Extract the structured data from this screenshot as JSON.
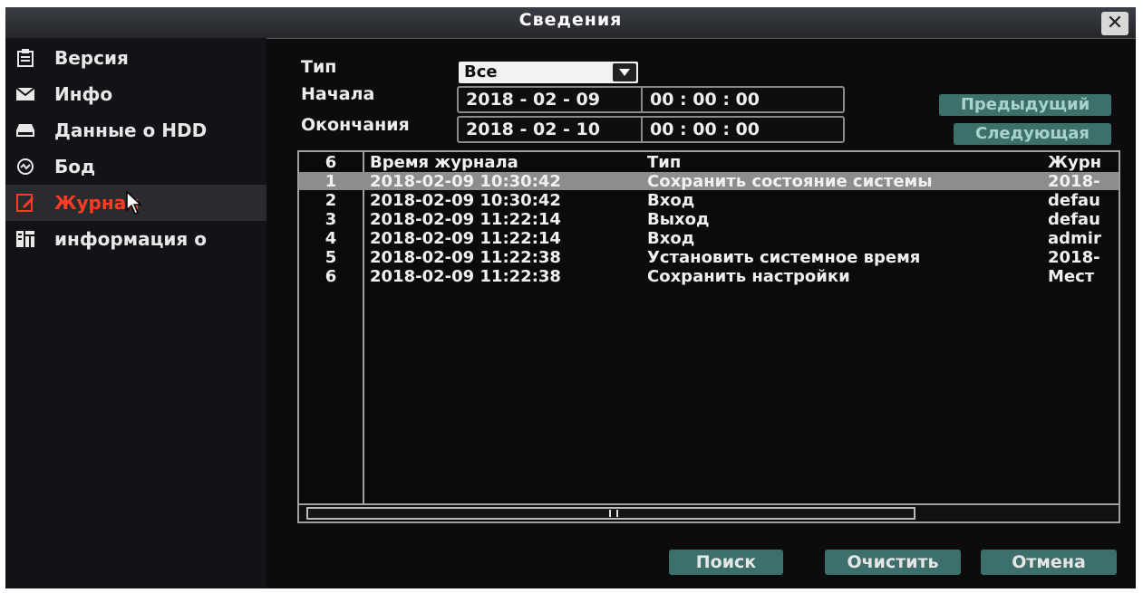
{
  "window": {
    "title": "Сведения"
  },
  "sidebar": {
    "items": [
      {
        "label": "Версия",
        "icon": "clipboard-icon"
      },
      {
        "label": "Инфо",
        "icon": "envelope-icon"
      },
      {
        "label": "Данные о HDD",
        "icon": "hdd-icon"
      },
      {
        "label": "Бод",
        "icon": "gauge-icon"
      },
      {
        "label": "Журнал",
        "icon": "log-icon",
        "active": true
      },
      {
        "label": "информация о",
        "icon": "info-grid-icon"
      }
    ]
  },
  "filter": {
    "type_label": "Тип",
    "type_value": "Все",
    "start_label": "Начала",
    "start_date": "2018 - 02 - 09",
    "start_time": "00 : 00 : 00",
    "end_label": "Окончания",
    "end_date": "2018 - 02 - 10",
    "end_time": "00 : 00 : 00",
    "prev_label": "Предыдущий",
    "next_label": "Следующая"
  },
  "log_table": {
    "count": "6",
    "columns": [
      "Время журнала",
      "Тип",
      "Журн"
    ],
    "rows": [
      {
        "n": "1",
        "time": "2018-02-09 10:30:42",
        "type": "Сохранить состояние системы",
        "detail": "2018-",
        "selected": true
      },
      {
        "n": "2",
        "time": "2018-02-09 10:30:42",
        "type": "Вход",
        "detail": "defau"
      },
      {
        "n": "3",
        "time": "2018-02-09 11:22:14",
        "type": "Выход",
        "detail": "defau"
      },
      {
        "n": "4",
        "time": "2018-02-09 11:22:14",
        "type": "Вход",
        "detail": "admir"
      },
      {
        "n": "5",
        "time": "2018-02-09 11:22:38",
        "type": "Установить системное время",
        "detail": "2018-"
      },
      {
        "n": "6",
        "time": "2018-02-09 11:22:38",
        "type": "Сохранить настройки",
        "detail": "Мест"
      }
    ]
  },
  "actions": {
    "search": "Поиск",
    "clear": "Очистить",
    "cancel": "Отмена"
  },
  "colors": {
    "active_menu": "#ff3b24",
    "button_teal": "#3d706c",
    "selected_row": "#8d8d8d"
  }
}
